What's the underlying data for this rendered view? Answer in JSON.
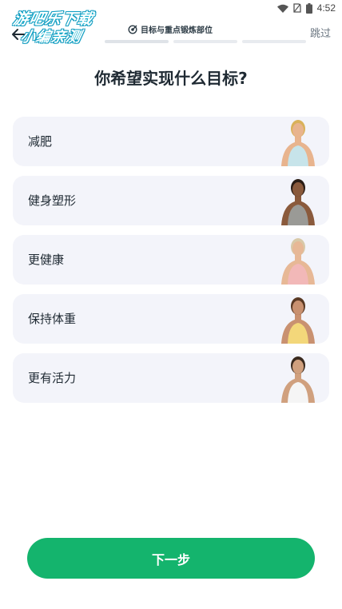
{
  "status_bar": {
    "time": "4:52"
  },
  "watermark": {
    "line1": "游吧乐下载",
    "line2": "小编亲测"
  },
  "header": {
    "step_title": "目标与重点锻炼部位",
    "skip_label": "跳过",
    "progress": {
      "total_steps": 3,
      "current_step": 1
    }
  },
  "page": {
    "title": "你希望实现什么目标?"
  },
  "options": [
    {
      "label": "减肥",
      "image": "woman-sports-bra-photo",
      "skin": "#e8b48e",
      "hair": "#d9b15a",
      "top": "#c7e4ea"
    },
    {
      "label": "健身塑形",
      "image": "muscular-man-tank-photo",
      "skin": "#8a5a3c",
      "hair": "#2a1d15",
      "top": "#9a9a96"
    },
    {
      "label": "更健康",
      "image": "older-woman-pink-top-photo",
      "skin": "#e7b896",
      "hair": "#d8c9a8",
      "top": "#f2b8b8"
    },
    {
      "label": "保持体重",
      "image": "woman-yellow-tank-photo",
      "skin": "#c99170",
      "hair": "#5a3a24",
      "top": "#f3d77a"
    },
    {
      "label": "更有活力",
      "image": "man-white-tshirt-photo",
      "skin": "#d0a07e",
      "hair": "#3a2a1e",
      "top": "#f5f5f5"
    }
  ],
  "footer": {
    "next_label": "下一步"
  },
  "colors": {
    "accent": "#14b46d",
    "card_bg": "#f3f4fa"
  }
}
